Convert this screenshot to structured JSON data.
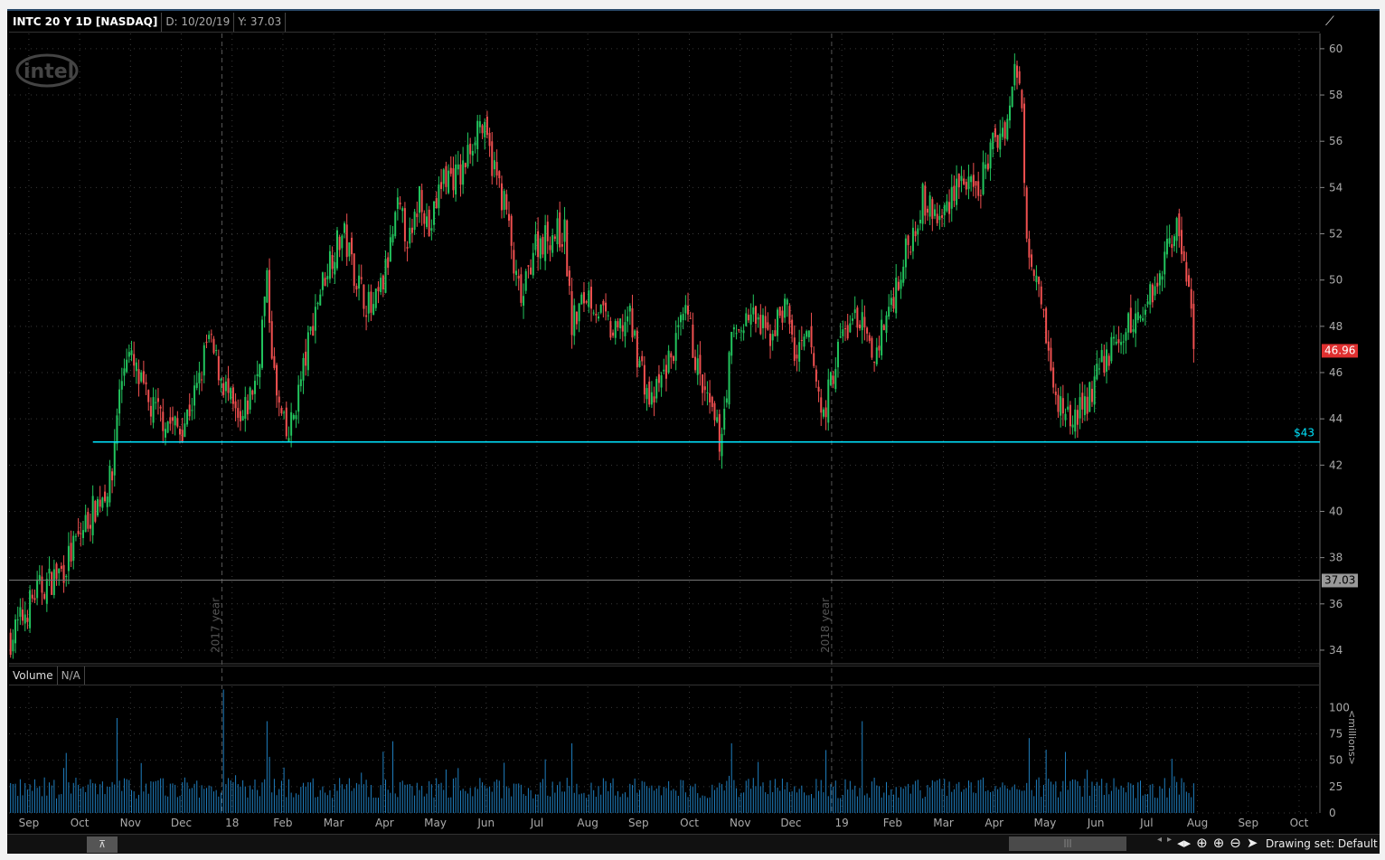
{
  "header": {
    "symbol": "INTC 20 Y 1D [NASDAQ]",
    "date": "D: 10/20/19",
    "y_value": "Y: 37.03"
  },
  "volume_header": {
    "label": "Volume",
    "value": "N/A"
  },
  "volume_unit": "<millions>",
  "logo": "intel",
  "footer": {
    "drawing_set": "Drawing set: Default"
  },
  "colors": {
    "up": "#22c55e",
    "down": "#f05050",
    "level": "#00e5ff",
    "volume": "#1f7fc0"
  },
  "chart_data": {
    "type": "candlestick",
    "title": "INTC 20 Y 1D [NASDAQ]",
    "x_unit": "months since Sep 2017",
    "xlim": [
      -0.39,
      25.41
    ],
    "ylim": [
      33.49,
      60.66
    ],
    "month_ticks": [
      "Sep",
      "Oct",
      "Nov",
      "Dec",
      "18",
      "Feb",
      "Mar",
      "Apr",
      "May",
      "Jun",
      "Jul",
      "Aug",
      "Sep",
      "Oct",
      "Nov",
      "Dec",
      "19",
      "Feb",
      "Mar",
      "Apr",
      "May",
      "Jun",
      "Jul",
      "Aug",
      "Sep",
      "Oct"
    ],
    "year_markers": [
      {
        "t": 3.8,
        "label": "2017 year"
      },
      {
        "t": 15.8,
        "label": "2018 year"
      }
    ],
    "y_ticks": [
      34,
      36,
      38,
      40,
      42,
      44,
      46,
      48,
      50,
      52,
      54,
      56,
      58,
      60
    ],
    "price_path": {
      "t": [
        -0.36,
        0.14,
        0.68,
        1.12,
        1.65,
        1.71,
        1.92,
        2.37,
        2.99,
        3.35,
        3.52,
        3.84,
        4.15,
        4.5,
        4.68,
        4.86,
        5.09,
        5.39,
        5.66,
        5.93,
        6.19,
        6.46,
        6.76,
        6.99,
        7.26,
        7.53,
        7.7,
        7.88,
        8.15,
        8.51,
        8.86,
        9.13,
        9.4,
        9.57,
        9.72,
        9.93,
        10.28,
        10.55,
        10.68,
        11.0,
        11.53,
        11.8,
        12.24,
        12.6,
        12.95,
        13.22,
        13.61,
        13.84,
        14.2,
        14.56,
        14.91,
        15.09,
        15.36,
        15.62,
        15.98,
        16.33,
        16.6,
        16.96,
        17.31,
        17.58,
        17.94,
        18.29,
        18.65,
        18.91,
        19.27,
        19.4,
        19.54,
        19.63,
        19.89,
        20.04,
        20.16,
        20.52,
        20.78,
        21.14,
        21.49,
        21.85,
        22.21,
        22.56,
        22.74,
        22.88,
        22.95
      ],
      "close": [
        34.5,
        36.5,
        37.5,
        39.5,
        41.5,
        44,
        47,
        44.5,
        43.5,
        45.5,
        47.5,
        45.5,
        43.5,
        46,
        50,
        45,
        43,
        46,
        49,
        51,
        52,
        50,
        48.5,
        50,
        53,
        51.5,
        54,
        52,
        54.5,
        54.5,
        57,
        55,
        53,
        50,
        49,
        51.5,
        52,
        52,
        48,
        49.5,
        47.5,
        48.5,
        44.5,
        46.5,
        48.5,
        45.5,
        43,
        47.5,
        48.5,
        47.5,
        49,
        46.5,
        47.5,
        44,
        47.5,
        48.5,
        46.5,
        49,
        51.5,
        53.5,
        52.5,
        54.5,
        53.5,
        55.5,
        57,
        59,
        58,
        52,
        50,
        47.5,
        45,
        44,
        44.5,
        46.5,
        47.5,
        48.5,
        50,
        52.5,
        51,
        49,
        47
      ]
    },
    "last_price": "46.96",
    "crosshair_price": "37.03",
    "level_line": {
      "price": 43,
      "start_t": 1.26,
      "label": "$43"
    },
    "volume": {
      "ylim": [
        0,
        120
      ],
      "y_ticks": [
        "100",
        "75",
        "50",
        "25",
        "0"
      ],
      "typical_millions": 25,
      "spikes": [
        {
          "t": 1.75,
          "v": 90
        },
        {
          "t": 3.85,
          "v": 117
        },
        {
          "t": 4.7,
          "v": 87
        },
        {
          "t": 7.15,
          "v": 68
        },
        {
          "t": 10.7,
          "v": 66
        },
        {
          "t": 13.85,
          "v": 66
        },
        {
          "t": 16.4,
          "v": 87
        },
        {
          "t": 19.7,
          "v": 71
        },
        {
          "t": 20.0,
          "v": 60
        }
      ]
    }
  }
}
